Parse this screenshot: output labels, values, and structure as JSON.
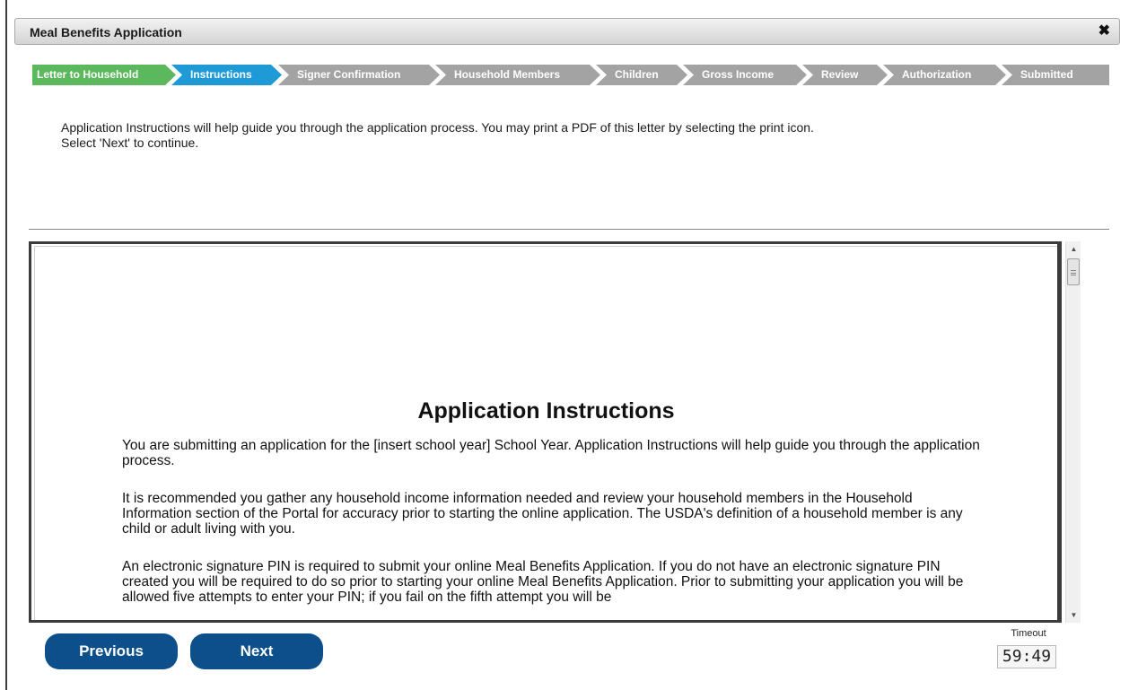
{
  "dialog": {
    "title": "Meal Benefits Application",
    "close_icon": "close-icon"
  },
  "steps": [
    {
      "label": "Letter to Household",
      "state": "done"
    },
    {
      "label": "Instructions",
      "state": "active"
    },
    {
      "label": "Signer Confirmation",
      "state": "pending"
    },
    {
      "label": "Household Members",
      "state": "pending"
    },
    {
      "label": "Children",
      "state": "pending"
    },
    {
      "label": "Gross Income",
      "state": "pending"
    },
    {
      "label": "Review",
      "state": "pending"
    },
    {
      "label": "Authorization",
      "state": "pending"
    },
    {
      "label": "Submitted",
      "state": "pending"
    }
  ],
  "intro": {
    "line1": "Application Instructions will help guide you through the application process. You may print a PDF of this letter by selecting the print icon.",
    "line2": "Select 'Next' to continue."
  },
  "document": {
    "title": "Application Instructions",
    "paragraphs": [
      "You are submitting an application for the [insert school year] School Year. Application Instructions will help guide you through the application process.",
      "It is recommended you gather any household income information needed and review your household members in the Household Information section of the Portal for accuracy prior to starting the online application. The USDA's definition of a household member is any child or adult living with you.",
      "An electronic signature PIN is required to submit your online Meal Benefits Application. If you do not have an electronic signature PIN created you will be required to do so prior to starting your online Meal Benefits Application. Prior to submitting your application you will be allowed five attempts to enter your PIN; if you fail on the fifth attempt you will be"
    ]
  },
  "buttons": {
    "previous": "Previous",
    "next": "Next"
  },
  "timeout": {
    "label": "Timeout",
    "value": "59:49"
  },
  "colors": {
    "done": "#5cb85c",
    "active": "#1e9ad6",
    "pending": "#a3a3a3",
    "button": "#0c4f8a"
  }
}
